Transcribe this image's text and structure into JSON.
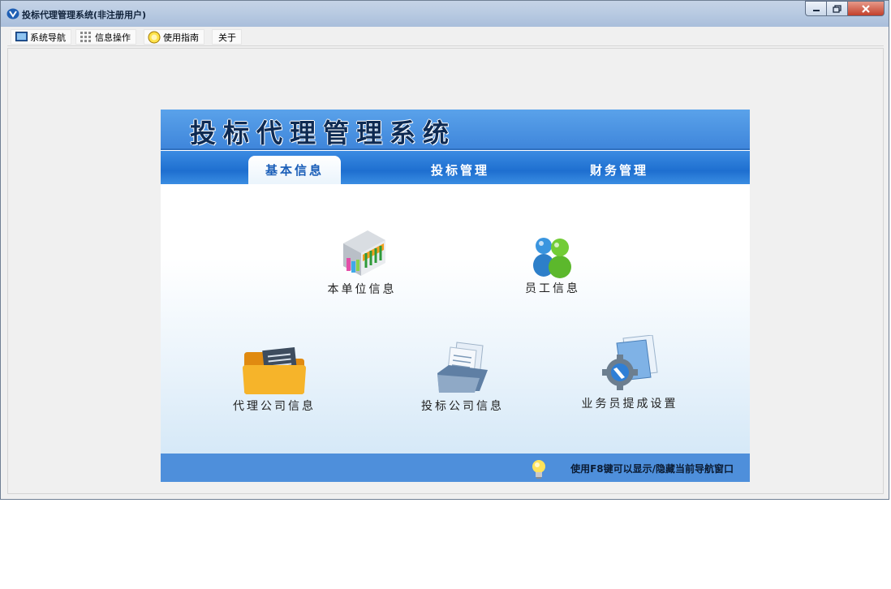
{
  "window": {
    "title": "投标代理管理系统(非注册用户)",
    "controls": [
      "minimize-icon",
      "maximize-icon",
      "close-icon"
    ]
  },
  "menubar": {
    "items": [
      {
        "label": "系统导航",
        "icon": "monitor-icon"
      },
      {
        "label": "信息操作",
        "icon": "grid-icon"
      },
      {
        "label": "使用指南",
        "icon": "help-icon"
      },
      {
        "label": "关于",
        "icon": ""
      }
    ]
  },
  "nav_panel": {
    "title": "投标代理管理系统",
    "tabs": [
      {
        "label": "基本信息",
        "active": true
      },
      {
        "label": "投标管理",
        "active": false
      },
      {
        "label": "财务管理",
        "active": false
      }
    ],
    "items": [
      {
        "label": "本单位信息",
        "icon": "store-icon"
      },
      {
        "label": "员工信息",
        "icon": "users-icon"
      },
      {
        "label": "代理公司信息",
        "icon": "folder-icon"
      },
      {
        "label": "投标公司信息",
        "icon": "documents-icon"
      },
      {
        "label": "业务员提成设置",
        "icon": "settings-icon"
      }
    ],
    "footer_hint": "使用F8键可以显示/隐藏当前导航窗口"
  },
  "colors": {
    "header_blue": "#4a93e3",
    "tab_blue": "#1e6fd0",
    "footer_blue": "#4e8fdb",
    "title_dark": "#0e2a52"
  }
}
